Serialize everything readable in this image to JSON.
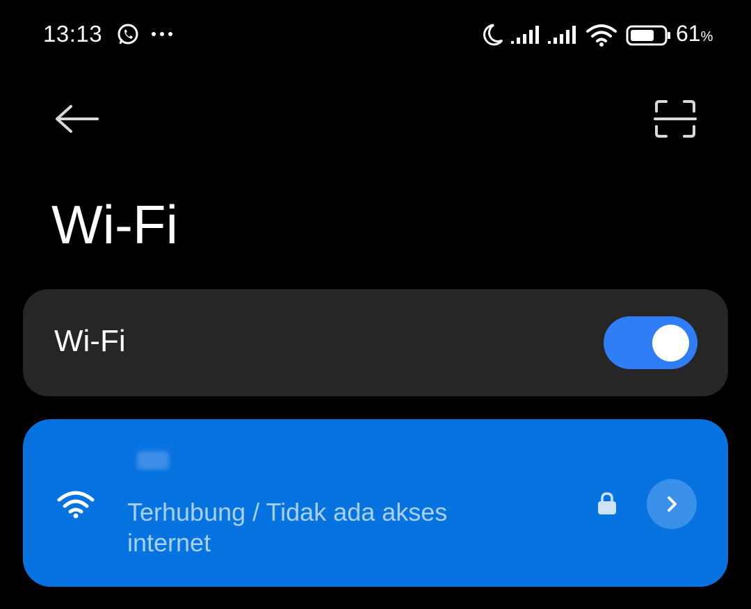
{
  "status_bar": {
    "time": "13:13",
    "battery_percent": "61",
    "battery_unit": "%",
    "icons": [
      "whatsapp-icon",
      "more-dots-icon",
      "moon-icon",
      "signal-icon",
      "signal-icon",
      "wifi-icon",
      "battery-icon"
    ]
  },
  "header": {
    "back_icon": "back-arrow-icon",
    "scan_icon": "scan-qr-icon",
    "title": "Wi-Fi"
  },
  "wifi_toggle": {
    "label": "Wi-Fi",
    "enabled": true,
    "accent_color": "#2f7ef5"
  },
  "connected_network": {
    "name": "",
    "status": "Terhubung / Tidak ada akses internet",
    "secured": true,
    "card_color": "#0673e0"
  }
}
